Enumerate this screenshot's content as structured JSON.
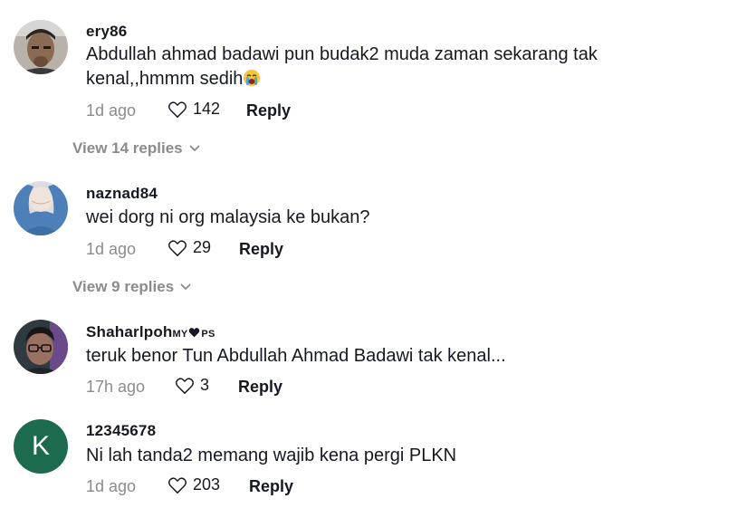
{
  "comments": [
    {
      "username": "ery86",
      "text": "Abdullah ahmad badawi pun budak2 muda zaman sekarang tak kenal,,hmmm sedih",
      "emoji": "loudly-crying-face-emoji",
      "time": "1d ago",
      "likes": "142",
      "reply_label": "Reply",
      "view_replies": "View 14 replies"
    },
    {
      "username": "naznad84",
      "text": "wei dorg ni org malaysia ke bukan?",
      "time": "1d ago",
      "likes": "29",
      "reply_label": "Reply",
      "view_replies": "View 9 replies"
    },
    {
      "username": "Shaharlpoh",
      "username_suffix_1": "MY",
      "username_suffix_2": "PS",
      "text": "teruk benor Tun Abdullah Ahmad Badawi tak kenal...",
      "time": "17h ago",
      "likes": "3",
      "reply_label": "Reply"
    },
    {
      "username": "12345678",
      "avatar_letter": "K",
      "text": "Ni lah tanda2 memang wajib kena pergi PLKN",
      "time": "1d ago",
      "likes": "203",
      "reply_label": "Reply"
    }
  ],
  "icons": {
    "like": "heart-outline-icon",
    "expand": "chevron-down-icon"
  },
  "colors": {
    "text": "#161823",
    "muted": "#8a8b91",
    "avatar_k": "#1c6b4f"
  }
}
